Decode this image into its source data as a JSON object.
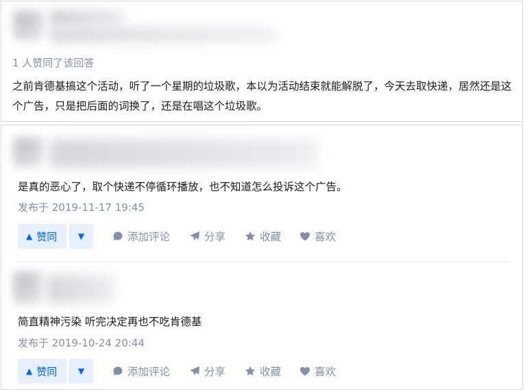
{
  "answer": {
    "votes_text": "1 人赞同了该回答",
    "body": "之前肯德基搞这个活动，听了一个星期的垃圾歌，本以为活动结束就能解脱了，今天去取快递，居然还是这个广告，只是把后面的词换了，还是在唱这个垃圾歌。"
  },
  "comments": [
    {
      "text": "是真的恶心了，取个快递不停循环播放，也不知道怎么投诉这个广告。",
      "date": "发布于 2019-11-17 19:45"
    },
    {
      "text": "简直精神污染 听完决定再也不吃肯德基",
      "date": "发布于 2019-10-24 20:44"
    }
  ],
  "actions": {
    "upvote": "赞同",
    "upvote_glyph": "▲",
    "downvote_glyph": "▼",
    "comment": "添加评论",
    "share": "分享",
    "favorite": "收藏",
    "like": "喜欢"
  },
  "colors": {
    "accent": "#0066ff",
    "accent_bg": "#e5effd",
    "meta": "#8590a6",
    "border": "#d9d9d9"
  },
  "icons": [
    "comment-icon",
    "share-icon",
    "star-icon",
    "heart-icon"
  ]
}
